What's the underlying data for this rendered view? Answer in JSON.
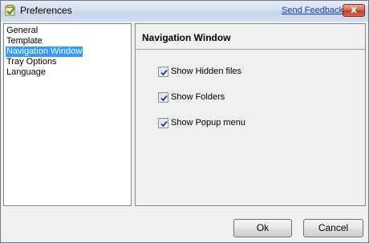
{
  "window": {
    "title": "Preferences",
    "feedback_link": "Send Feedback",
    "close_glyph": "x"
  },
  "sidebar": {
    "items": [
      {
        "label": "General",
        "selected": false
      },
      {
        "label": "Template",
        "selected": false
      },
      {
        "label": "Navigation Window",
        "selected": true
      },
      {
        "label": "Tray Options",
        "selected": false
      },
      {
        "label": "Language",
        "selected": false
      }
    ]
  },
  "panel": {
    "title": "Navigation Window",
    "options": [
      {
        "label": "Show Hidden files",
        "checked": true
      },
      {
        "label": "Show Folders",
        "checked": true
      },
      {
        "label": "Show Popup menu",
        "checked": true
      }
    ]
  },
  "buttons": {
    "ok": "Ok",
    "cancel": "Cancel"
  },
  "colors": {
    "selection": "#3399ff",
    "link": "#1a3fa8",
    "close": "#c23d24"
  }
}
